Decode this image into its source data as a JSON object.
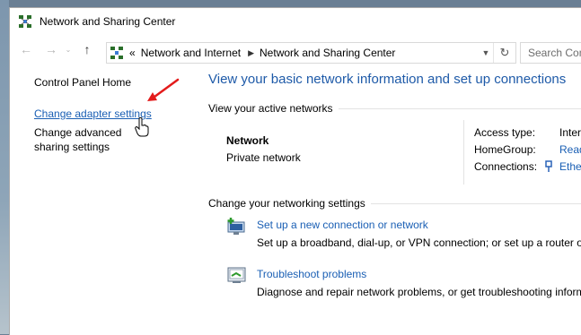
{
  "window": {
    "title": "Network and Sharing Center"
  },
  "nav": {
    "back_icon": "back-arrow-icon",
    "forward_icon": "forward-arrow-icon",
    "up_icon": "up-arrow-icon"
  },
  "address": {
    "overflow": "«",
    "segments": [
      "Network and Internet",
      "Network and Sharing Center"
    ]
  },
  "search": {
    "placeholder": "Search Con"
  },
  "sidebar": {
    "home": "Control Panel Home",
    "adapter": "Change adapter settings",
    "advanced": "Change advanced sharing settings"
  },
  "main": {
    "title": "View your basic network information and set up connections",
    "active_heading": "View your active networks",
    "network": {
      "name": "Network",
      "type": "Private network"
    },
    "props": [
      {
        "label": "Access type:",
        "value": "Inter"
      },
      {
        "label": "HomeGroup:",
        "value": "Read"
      },
      {
        "label": "Connections:",
        "value": "Ethe"
      }
    ],
    "change_heading": "Change your networking settings",
    "tasks": [
      {
        "link": "Set up a new connection or network",
        "desc": "Set up a broadband, dial-up, or VPN connection; or set up a router or"
      },
      {
        "link": "Troubleshoot problems",
        "desc": "Diagnose and repair network problems, or get troubleshooting inform"
      }
    ]
  },
  "colors": {
    "link": "#1a5fb4",
    "title": "#1e5aa8",
    "annotation": "#e31b1b"
  }
}
